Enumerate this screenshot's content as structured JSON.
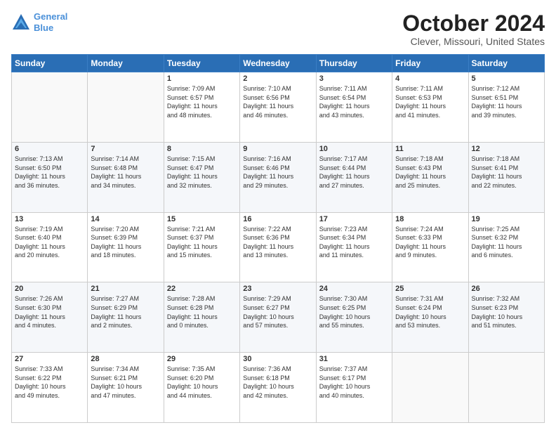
{
  "logo": {
    "line1": "General",
    "line2": "Blue"
  },
  "header": {
    "month": "October 2024",
    "location": "Clever, Missouri, United States"
  },
  "weekdays": [
    "Sunday",
    "Monday",
    "Tuesday",
    "Wednesday",
    "Thursday",
    "Friday",
    "Saturday"
  ],
  "weeks": [
    [
      {
        "day": "",
        "info": ""
      },
      {
        "day": "",
        "info": ""
      },
      {
        "day": "1",
        "info": "Sunrise: 7:09 AM\nSunset: 6:57 PM\nDaylight: 11 hours\nand 48 minutes."
      },
      {
        "day": "2",
        "info": "Sunrise: 7:10 AM\nSunset: 6:56 PM\nDaylight: 11 hours\nand 46 minutes."
      },
      {
        "day": "3",
        "info": "Sunrise: 7:11 AM\nSunset: 6:54 PM\nDaylight: 11 hours\nand 43 minutes."
      },
      {
        "day": "4",
        "info": "Sunrise: 7:11 AM\nSunset: 6:53 PM\nDaylight: 11 hours\nand 41 minutes."
      },
      {
        "day": "5",
        "info": "Sunrise: 7:12 AM\nSunset: 6:51 PM\nDaylight: 11 hours\nand 39 minutes."
      }
    ],
    [
      {
        "day": "6",
        "info": "Sunrise: 7:13 AM\nSunset: 6:50 PM\nDaylight: 11 hours\nand 36 minutes."
      },
      {
        "day": "7",
        "info": "Sunrise: 7:14 AM\nSunset: 6:48 PM\nDaylight: 11 hours\nand 34 minutes."
      },
      {
        "day": "8",
        "info": "Sunrise: 7:15 AM\nSunset: 6:47 PM\nDaylight: 11 hours\nand 32 minutes."
      },
      {
        "day": "9",
        "info": "Sunrise: 7:16 AM\nSunset: 6:46 PM\nDaylight: 11 hours\nand 29 minutes."
      },
      {
        "day": "10",
        "info": "Sunrise: 7:17 AM\nSunset: 6:44 PM\nDaylight: 11 hours\nand 27 minutes."
      },
      {
        "day": "11",
        "info": "Sunrise: 7:18 AM\nSunset: 6:43 PM\nDaylight: 11 hours\nand 25 minutes."
      },
      {
        "day": "12",
        "info": "Sunrise: 7:18 AM\nSunset: 6:41 PM\nDaylight: 11 hours\nand 22 minutes."
      }
    ],
    [
      {
        "day": "13",
        "info": "Sunrise: 7:19 AM\nSunset: 6:40 PM\nDaylight: 11 hours\nand 20 minutes."
      },
      {
        "day": "14",
        "info": "Sunrise: 7:20 AM\nSunset: 6:39 PM\nDaylight: 11 hours\nand 18 minutes."
      },
      {
        "day": "15",
        "info": "Sunrise: 7:21 AM\nSunset: 6:37 PM\nDaylight: 11 hours\nand 15 minutes."
      },
      {
        "day": "16",
        "info": "Sunrise: 7:22 AM\nSunset: 6:36 PM\nDaylight: 11 hours\nand 13 minutes."
      },
      {
        "day": "17",
        "info": "Sunrise: 7:23 AM\nSunset: 6:34 PM\nDaylight: 11 hours\nand 11 minutes."
      },
      {
        "day": "18",
        "info": "Sunrise: 7:24 AM\nSunset: 6:33 PM\nDaylight: 11 hours\nand 9 minutes."
      },
      {
        "day": "19",
        "info": "Sunrise: 7:25 AM\nSunset: 6:32 PM\nDaylight: 11 hours\nand 6 minutes."
      }
    ],
    [
      {
        "day": "20",
        "info": "Sunrise: 7:26 AM\nSunset: 6:30 PM\nDaylight: 11 hours\nand 4 minutes."
      },
      {
        "day": "21",
        "info": "Sunrise: 7:27 AM\nSunset: 6:29 PM\nDaylight: 11 hours\nand 2 minutes."
      },
      {
        "day": "22",
        "info": "Sunrise: 7:28 AM\nSunset: 6:28 PM\nDaylight: 11 hours\nand 0 minutes."
      },
      {
        "day": "23",
        "info": "Sunrise: 7:29 AM\nSunset: 6:27 PM\nDaylight: 10 hours\nand 57 minutes."
      },
      {
        "day": "24",
        "info": "Sunrise: 7:30 AM\nSunset: 6:25 PM\nDaylight: 10 hours\nand 55 minutes."
      },
      {
        "day": "25",
        "info": "Sunrise: 7:31 AM\nSunset: 6:24 PM\nDaylight: 10 hours\nand 53 minutes."
      },
      {
        "day": "26",
        "info": "Sunrise: 7:32 AM\nSunset: 6:23 PM\nDaylight: 10 hours\nand 51 minutes."
      }
    ],
    [
      {
        "day": "27",
        "info": "Sunrise: 7:33 AM\nSunset: 6:22 PM\nDaylight: 10 hours\nand 49 minutes."
      },
      {
        "day": "28",
        "info": "Sunrise: 7:34 AM\nSunset: 6:21 PM\nDaylight: 10 hours\nand 47 minutes."
      },
      {
        "day": "29",
        "info": "Sunrise: 7:35 AM\nSunset: 6:20 PM\nDaylight: 10 hours\nand 44 minutes."
      },
      {
        "day": "30",
        "info": "Sunrise: 7:36 AM\nSunset: 6:18 PM\nDaylight: 10 hours\nand 42 minutes."
      },
      {
        "day": "31",
        "info": "Sunrise: 7:37 AM\nSunset: 6:17 PM\nDaylight: 10 hours\nand 40 minutes."
      },
      {
        "day": "",
        "info": ""
      },
      {
        "day": "",
        "info": ""
      }
    ]
  ]
}
